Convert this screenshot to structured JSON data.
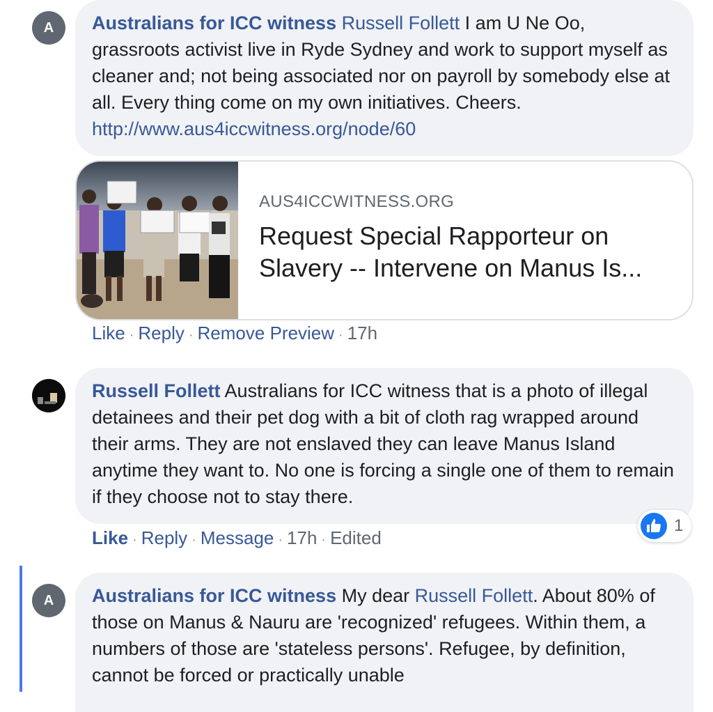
{
  "comments": [
    {
      "avatar_letter": "A",
      "author": "Australians for ICC witness",
      "mention": "Russell Follett",
      "text": " I am U Ne Oo, grassroots activist live in Ryde Sydney and work to support myself as cleaner and; not being associated nor on payroll by somebody else at all. Every thing come on my own initiatives. Cheers. ",
      "link": "http://www.aus4iccwitness.org/node/60",
      "preview": {
        "domain": "AUS4ICCWITNESS.ORG",
        "title": "Request Special Rapporteur on Slavery -- Intervene on Manus Is..."
      },
      "actions": {
        "like": "Like",
        "reply": "Reply",
        "remove_preview": "Remove Preview",
        "time": "17h"
      }
    },
    {
      "author": "Russell Follett",
      "text": " Australians for ICC witness that is a photo of illegal detainees and their pet dog with a bit of cloth rag wrapped around their arms. They are not enslaved they can leave Manus Island anytime they want to. No one is forcing a single one of them to remain if they choose not to stay there.",
      "actions": {
        "like": "Like",
        "reply": "Reply",
        "message": "Message",
        "time": "17h",
        "edited": "Edited"
      },
      "reaction_count": "1",
      "reaction_icon": "thumbs-up-icon"
    },
    {
      "avatar_letter": "A",
      "author": "Australians for ICC witness",
      "text_before": " My dear ",
      "mention": "Russell Follett",
      "text": ". About 80% of those on Manus & Nauru are 'recognized' refugees. Within them, a numbers of those are 'stateless persons'. Refugee, by definition, cannot be forced or practically unable"
    }
  ],
  "separator": "·",
  "colors": {
    "link": "#385898",
    "bubble": "#f0f2f5",
    "like_blue": "#1877f2",
    "thread_line": "#4a7be8"
  }
}
